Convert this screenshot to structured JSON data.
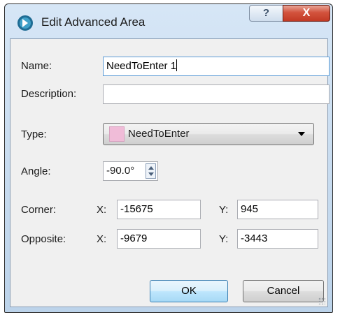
{
  "window": {
    "title": "Edit Advanced Area",
    "help_label": "?",
    "close_label": "X"
  },
  "form": {
    "name_label": "Name:",
    "name_value": "NeedToEnter 1",
    "description_label": "Description:",
    "description_value": "",
    "type_label": "Type:",
    "type_value": "NeedToEnter",
    "type_color": "#f0bcd8",
    "angle_label": "Angle:",
    "angle_value": "-90.0°",
    "corner_label": "Corner:",
    "corner_x_label": "X:",
    "corner_x_value": "-15675",
    "corner_y_label": "Y:",
    "corner_y_value": "945",
    "opposite_label": "Opposite:",
    "opposite_x_label": "X:",
    "opposite_x_value": "-9679",
    "opposite_y_label": "Y:",
    "opposite_y_value": "-3443"
  },
  "buttons": {
    "ok_label": "OK",
    "cancel_label": "Cancel"
  }
}
